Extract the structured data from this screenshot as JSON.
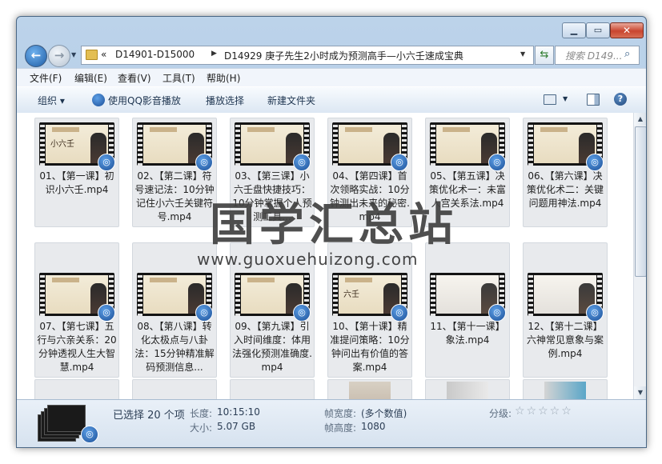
{
  "address": {
    "chevron": "«",
    "crumbs": [
      "D14901-D15000",
      "D14929 庚子先生2小时成为预测高手—小六壬速成宝典"
    ],
    "separator": "▶"
  },
  "search": {
    "placeholder": "搜索 D149..."
  },
  "menu": [
    "文件(F)",
    "编辑(E)",
    "查看(V)",
    "工具(T)",
    "帮助(H)"
  ],
  "toolbar": {
    "organize": "组织 ▾",
    "play_qq": "使用QQ影音播放",
    "play_select": "播放选择",
    "new_folder": "新建文件夹"
  },
  "files": [
    {
      "name": "01、【第一课】初识小六壬.mp4",
      "thumb_title": "小六壬"
    },
    {
      "name": "02、【第二课】符号速记法：10分钟记住小六壬关键符号.mp4",
      "thumb_title": ""
    },
    {
      "name": "03、【第三课】小六壬盘快捷技巧：10分钟掌握个人预测工具...",
      "thumb_title": ""
    },
    {
      "name": "04、【第四课】首次领略实战：10分钟测出未来的秘密.mp4",
      "thumb_title": ""
    },
    {
      "name": "05、【第五课】决策优化术一：未富人宫关系法.mp4",
      "thumb_title": ""
    },
    {
      "name": "06、【第六课】决策优化术二：关键问题用神法.mp4",
      "thumb_title": ""
    },
    {
      "name": "07、【第七课】五行与六亲关系：20分钟透视人生大智慧.mp4",
      "thumb_title": ""
    },
    {
      "name": "08、【第八课】转化太极点与八卦法：15分钟精准解码预测信息...",
      "thumb_title": ""
    },
    {
      "name": "09、【第九课】引入时间维度：体用法强化预测准确度.mp4",
      "thumb_title": ""
    },
    {
      "name": "10、【第十课】精准提问策略：10分钟问出有价值的答案.mp4",
      "thumb_title": "六壬"
    },
    {
      "name": "11、【第十一课】象法.mp4",
      "thumb_title": ""
    },
    {
      "name": "12、【第十二课】六神常见意象与案例.mp4",
      "thumb_title": ""
    }
  ],
  "watermark": {
    "cn": "国学汇总站",
    "url": "www.guoxuehuizong.com"
  },
  "details": {
    "selected": "已选择 20 个项",
    "length_label": "长度:",
    "length_value": "10:15:10",
    "size_label": "大小:",
    "size_value": "5.07 GB",
    "frame_width_label": "帧宽度:",
    "frame_width_value": "(多个数值)",
    "frame_height_label": "帧高度:",
    "frame_height_value": "1080",
    "rating_label": "分级:",
    "rating_stars": "☆☆☆☆☆"
  },
  "icons": {
    "back": "back-arrow-icon",
    "forward": "forward-arrow-icon",
    "refresh": "refresh-icon",
    "search": "search-icon",
    "folder": "folder-icon",
    "badge": "qq-player-icon"
  },
  "colors": {
    "titlebar": "#bcd3ea",
    "close": "#c9452f",
    "tile": "#e8eaed"
  }
}
